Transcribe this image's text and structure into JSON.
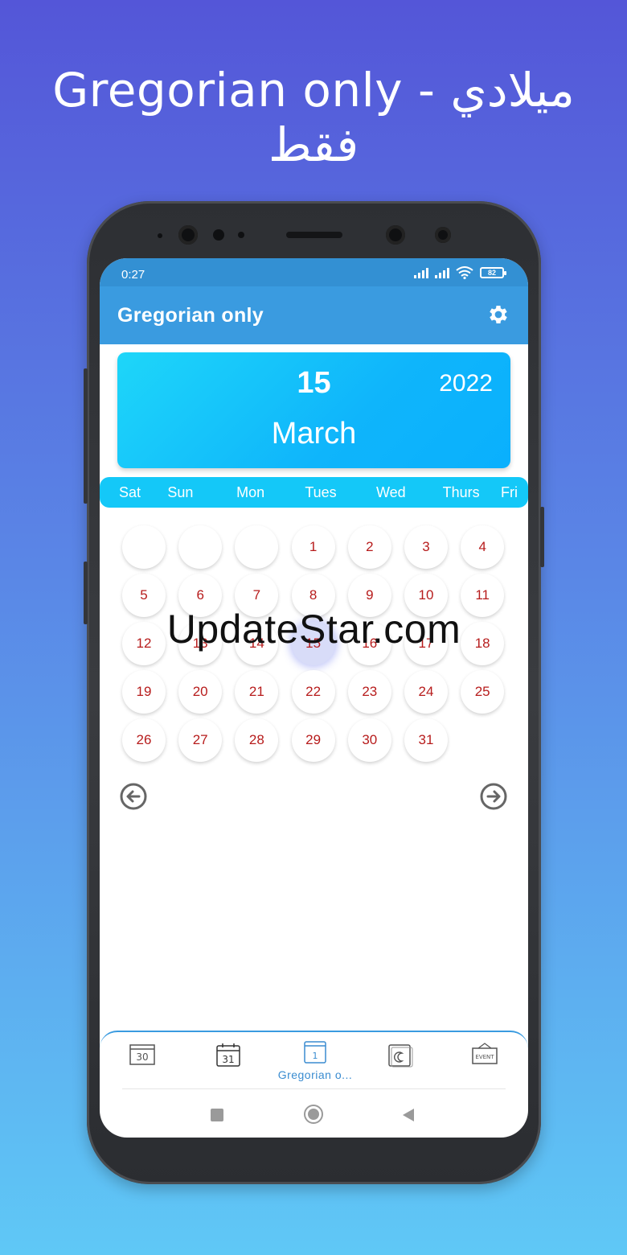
{
  "promo": {
    "title": "Gregorian only - ميلادي فقط"
  },
  "status_bar": {
    "time": "0:27",
    "battery": "82"
  },
  "app_bar": {
    "title": "Gregorian only",
    "settings_icon": "gear-icon"
  },
  "date_card": {
    "day": "15",
    "year": "2022",
    "month": "March"
  },
  "weekdays": [
    "Sat",
    "Sun",
    "Mon",
    "Tues",
    "Wed",
    "Thurs",
    "Fri"
  ],
  "calendar": {
    "leading_blanks": 3,
    "days": [
      "1",
      "2",
      "3",
      "4",
      "5",
      "6",
      "7",
      "8",
      "9",
      "10",
      "11",
      "12",
      "13",
      "14",
      "15",
      "16",
      "17",
      "18",
      "19",
      "20",
      "21",
      "22",
      "23",
      "24",
      "25",
      "26",
      "27",
      "28",
      "29",
      "30",
      "31"
    ],
    "selected_day": "15",
    "day_color": "#b71c1c"
  },
  "watermark": "UpdateStar.com",
  "bottom_nav": {
    "items": [
      {
        "icon": "calendar-30-icon",
        "label": ""
      },
      {
        "icon": "calendar-31-icon",
        "label": ""
      },
      {
        "icon": "calendar-1-icon",
        "label": "Gregorian o..."
      },
      {
        "icon": "hijri-calendar-icon",
        "label": ""
      },
      {
        "icon": "event-board-icon",
        "label": ""
      }
    ],
    "icon_texts": [
      "30",
      "31",
      "1",
      "EVENT"
    ]
  },
  "colors": {
    "accent": "#3a9be0",
    "status_bar": "#3390d3",
    "weekbar": "#14c8f8"
  }
}
